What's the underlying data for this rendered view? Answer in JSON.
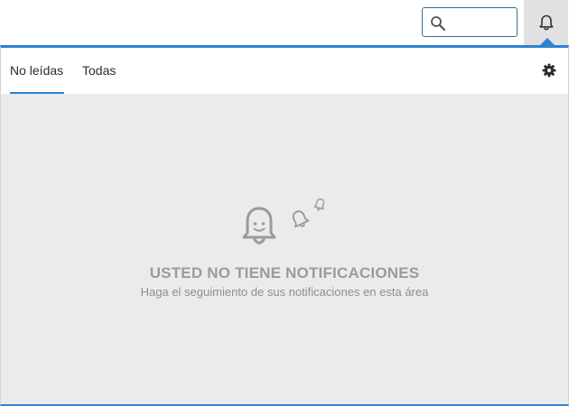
{
  "header": {
    "search": {
      "value": "",
      "placeholder": "",
      "icon": "search-icon"
    },
    "notifications_icon": "bell-icon"
  },
  "panel": {
    "tabs": [
      {
        "label": "No leídas",
        "active": true
      },
      {
        "label": "Todas",
        "active": false
      }
    ],
    "settings_icon": "gear-icon",
    "empty_state": {
      "title": "USTED NO TIENE NOTIFICACIONES",
      "subtitle": "Haga el seguimiento de sus notificaciones en esta área",
      "icons": [
        "bell-face-icon",
        "small-bell-icon",
        "tiny-bell-icon"
      ]
    }
  },
  "colors": {
    "accent": "#2d82d0",
    "panel_background": "#ebebeb",
    "muted_text": "#9b9b9b",
    "bell_button_background": "#e1e1e1"
  }
}
